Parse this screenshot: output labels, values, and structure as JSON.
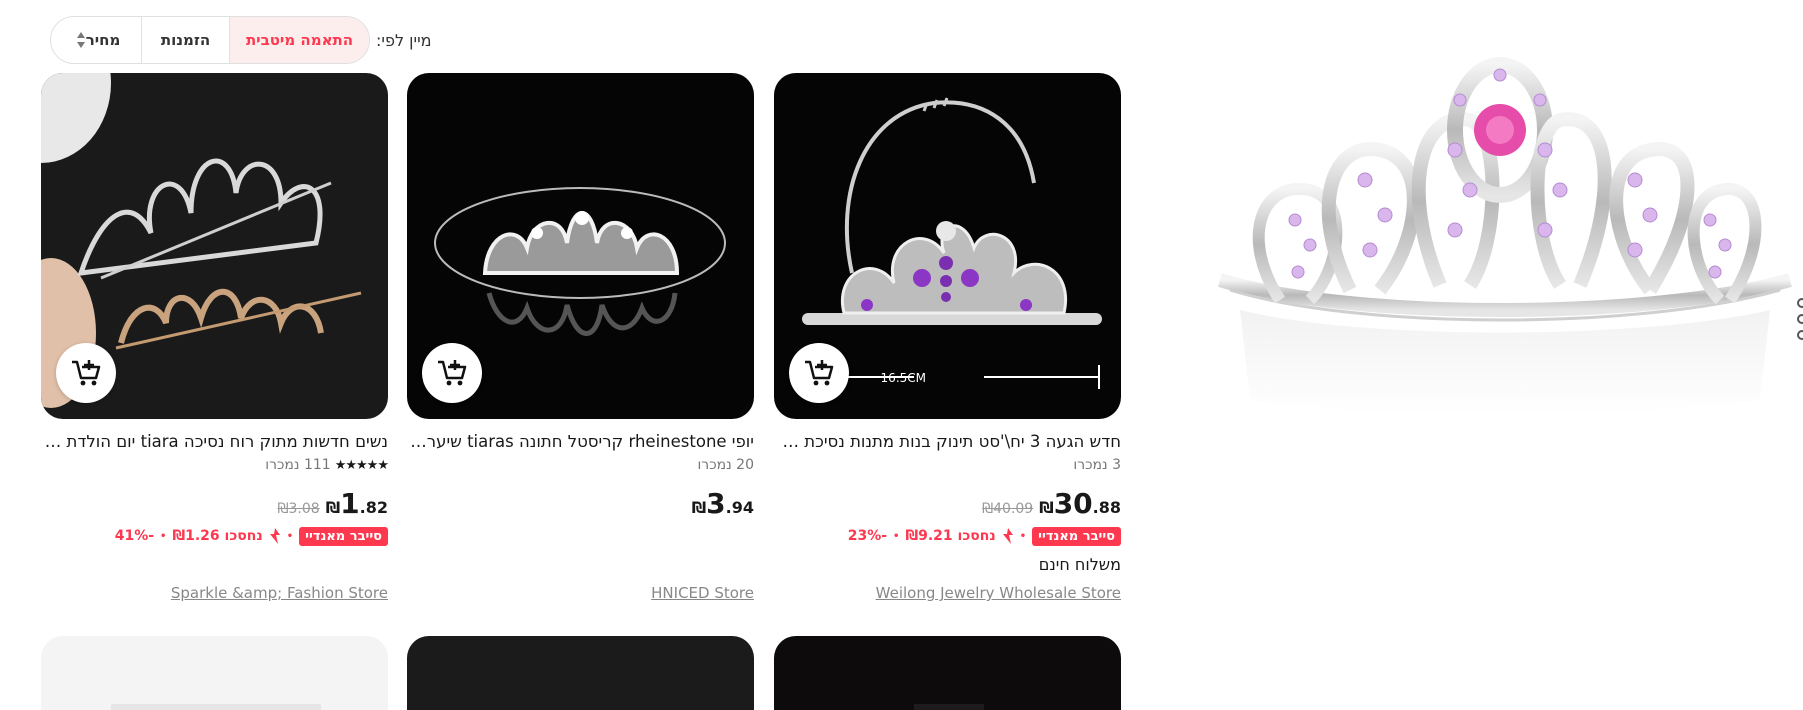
{
  "sort": {
    "label": "מיין לפי:",
    "options": [
      "התאמה מיטבית",
      "הזמנות",
      "מחיר"
    ],
    "active": "התאמה מיטבית"
  },
  "products": [
    {
      "title": "חדש הגעה 3 יח\\'סט תינוק בנות מתנות נסיכת כך ···",
      "sold": "3 נמכרו",
      "price_currency": "₪",
      "price_int": "30",
      "price_dec": ".88",
      "old_price": "₪40.09",
      "badge": "סייבר מאנדיי",
      "saved": "נחסכו ₪9.21",
      "discount": "-23%",
      "shipping": "משלוח חינם",
      "store": "Weilong Jewelry Wholesale Store"
    },
    {
      "title": "יופי rheinestone קריסטל חתונה tiaras שיער מ···",
      "sold": "20 נמכרו",
      "price_currency": "₪",
      "price_int": "3",
      "price_dec": ".94",
      "store": "HNICED Store"
    },
    {
      "title": "נשים חדשות מתוק רוח נסיכה tiara יום הולדת הכ···",
      "stars": "★★★★★",
      "rating": 5,
      "sold": "111 נמכרו",
      "price_currency": "₪",
      "price_int": "1",
      "price_dec": ".82",
      "old_price": "₪3.08",
      "badge": "סייבר מאנדיי",
      "saved": "נחסכו ₪1.26",
      "discount": "-41%",
      "store": "Sparkle &amp; Fashion Store"
    }
  ],
  "icons": {
    "cart": "add-to-cart-icon",
    "flame": "flame-icon",
    "sort_arrows": "sort-arrows-icon"
  },
  "colors": {
    "accent": "#fd384f",
    "text": "#191919",
    "muted": "#777777"
  }
}
